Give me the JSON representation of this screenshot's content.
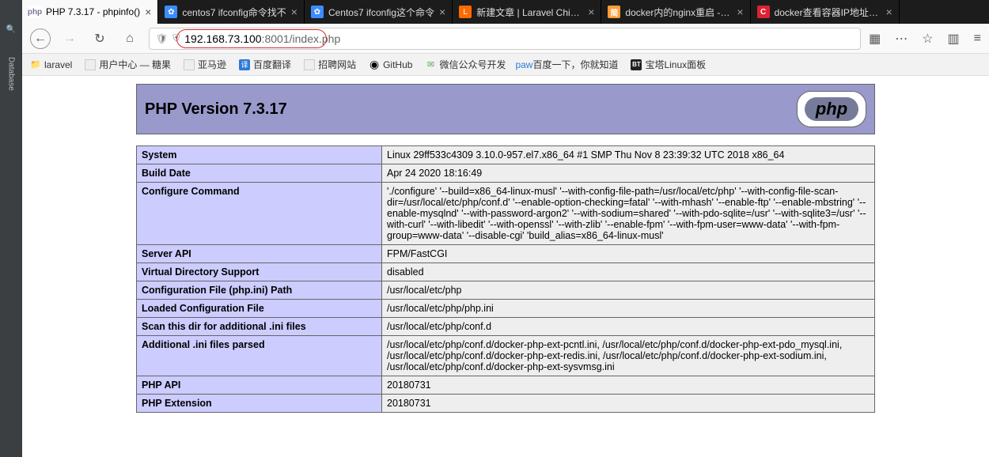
{
  "ide": {
    "icon1": "🔍",
    "label1": "Database"
  },
  "tabs": [
    {
      "fav": "php",
      "title": "PHP 7.3.17 - phpinfo()",
      "active": true
    },
    {
      "fav": "blue",
      "title": "centos7 ifconfig命令找不",
      "active": false
    },
    {
      "fav": "blue",
      "title": "Centos7 ifconfig这个命令",
      "active": false
    },
    {
      "fav": "orange",
      "title": "新建文章 | Laravel China社",
      "active": false
    },
    {
      "fav": "simple",
      "title": "docker内的nginx重启 - 简",
      "active": false
    },
    {
      "fav": "red",
      "title": "docker查看容器IP地址_运",
      "active": false
    }
  ],
  "nav": {
    "back": "←",
    "forward": "→",
    "reload": "↻",
    "home": "⌂"
  },
  "url": {
    "host": "192.168.73.100",
    "port": ":8001",
    "path": "/index.php"
  },
  "right": {
    "qr": "▦",
    "more": "⋯",
    "star": "☆",
    "book": "▥",
    "menu": "≡"
  },
  "bookmarks": [
    {
      "icon": "folder",
      "label": "laravel"
    },
    {
      "icon": "square",
      "label": "用户中心 — 糖果"
    },
    {
      "icon": "square",
      "label": "亚马逊"
    },
    {
      "icon": "zh",
      "label": "百度翻译"
    },
    {
      "icon": "square",
      "label": "招聘网站"
    },
    {
      "icon": "gh",
      "label": "GitHub"
    },
    {
      "icon": "wx",
      "label": "微信公众号开发"
    },
    {
      "icon": "bd",
      "label": "百度一下，你就知道"
    },
    {
      "icon": "bt",
      "label": "宝塔Linux面板"
    }
  ],
  "php": {
    "version_title": "PHP Version 7.3.17",
    "logo_text": "php",
    "rows": [
      {
        "k": "System",
        "v": "Linux 29ff533c4309 3.10.0-957.el7.x86_64 #1 SMP Thu Nov 8 23:39:32 UTC 2018 x86_64"
      },
      {
        "k": "Build Date",
        "v": "Apr 24 2020 18:16:49"
      },
      {
        "k": "Configure Command",
        "v": "'./configure' '--build=x86_64-linux-musl' '--with-config-file-path=/usr/local/etc/php' '--with-config-file-scan-dir=/usr/local/etc/php/conf.d' '--enable-option-checking=fatal' '--with-mhash' '--enable-ftp' '--enable-mbstring' '--enable-mysqlnd' '--with-password-argon2' '--with-sodium=shared' '--with-pdo-sqlite=/usr' '--with-sqlite3=/usr' '--with-curl' '--with-libedit' '--with-openssl' '--with-zlib' '--enable-fpm' '--with-fpm-user=www-data' '--with-fpm-group=www-data' '--disable-cgi' 'build_alias=x86_64-linux-musl'"
      },
      {
        "k": "Server API",
        "v": "FPM/FastCGI"
      },
      {
        "k": "Virtual Directory Support",
        "v": "disabled"
      },
      {
        "k": "Configuration File (php.ini) Path",
        "v": "/usr/local/etc/php"
      },
      {
        "k": "Loaded Configuration File",
        "v": "/usr/local/etc/php/php.ini"
      },
      {
        "k": "Scan this dir for additional .ini files",
        "v": "/usr/local/etc/php/conf.d"
      },
      {
        "k": "Additional .ini files parsed",
        "v": "/usr/local/etc/php/conf.d/docker-php-ext-pcntl.ini, /usr/local/etc/php/conf.d/docker-php-ext-pdo_mysql.ini, /usr/local/etc/php/conf.d/docker-php-ext-redis.ini, /usr/local/etc/php/conf.d/docker-php-ext-sodium.ini, /usr/local/etc/php/conf.d/docker-php-ext-sysvmsg.ini"
      },
      {
        "k": "PHP API",
        "v": "20180731"
      },
      {
        "k": "PHP Extension",
        "v": "20180731"
      }
    ]
  }
}
